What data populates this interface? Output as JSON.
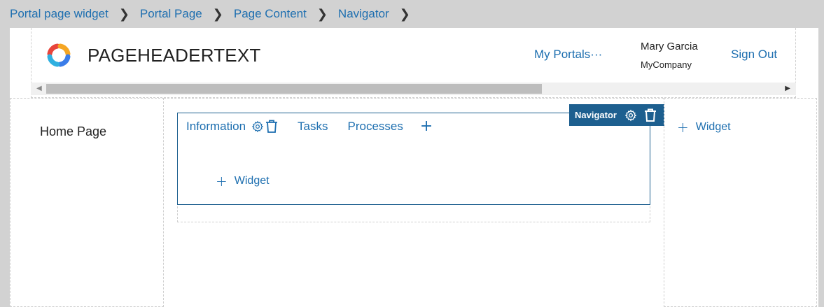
{
  "breadcrumb": {
    "items": [
      "Portal page widget",
      "Portal Page",
      "Page Content",
      "Navigator"
    ],
    "separator": ">"
  },
  "header": {
    "title": "PAGEHEADERTEXT",
    "my_portals": "My Portals···",
    "user_name": "Mary Garcia",
    "user_company": "MyCompany",
    "sign_out": "Sign Out"
  },
  "sidebar": {
    "home_label": "Home Page"
  },
  "navigator": {
    "badge_label": "Navigator",
    "tabs": [
      "Information",
      "Tasks",
      "Processes"
    ],
    "add_tab_glyph": "+",
    "add_widget_label": "Widget"
  },
  "right_column": {
    "add_widget_label": "Widget"
  },
  "colors": {
    "link": "#1e6fb0",
    "navigator_accent": "#1d5f8f",
    "page_bg": "#d2d2d2"
  }
}
